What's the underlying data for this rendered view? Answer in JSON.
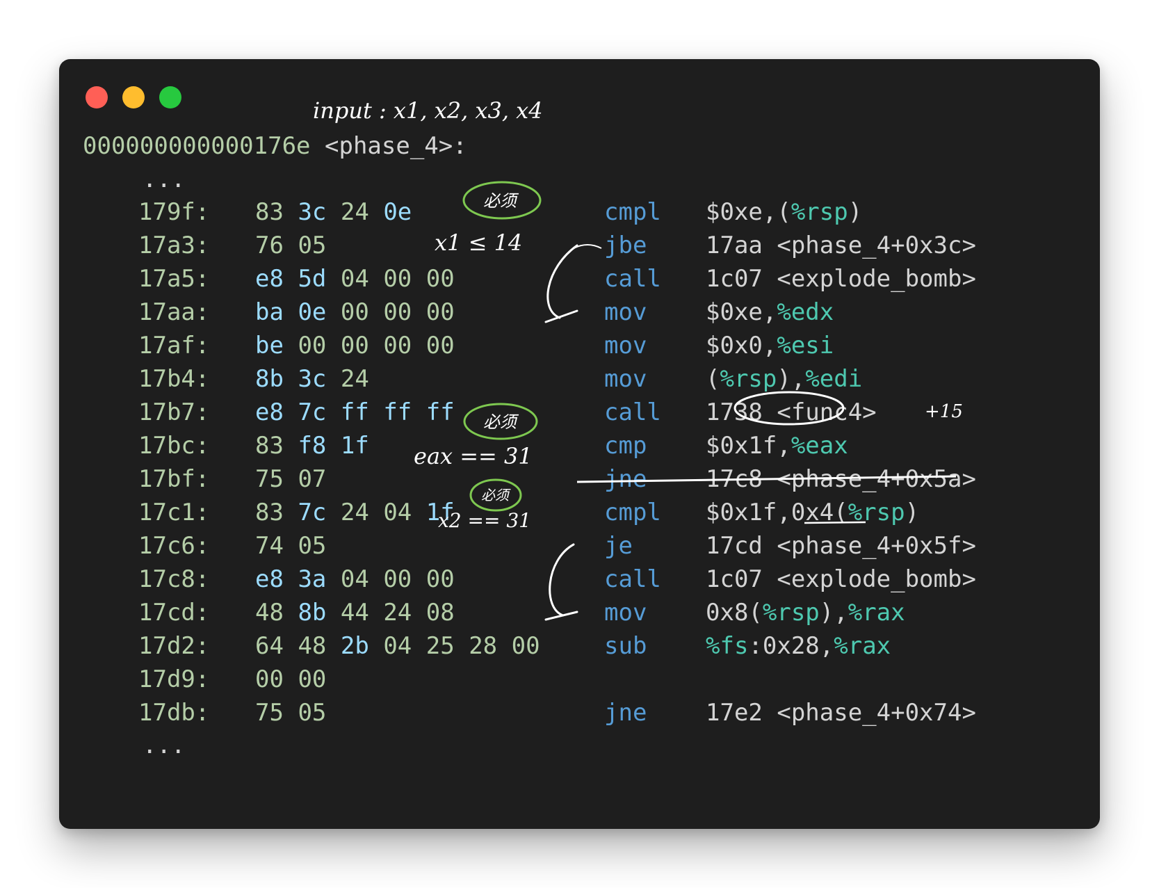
{
  "window": {
    "controls": [
      {
        "name": "close",
        "color": "#ff5f56"
      },
      {
        "name": "minimize",
        "color": "#ffbd2e"
      },
      {
        "name": "zoom",
        "color": "#27c93f"
      }
    ]
  },
  "header": {
    "address": "000000000000176e",
    "symbol": "<phase_4>:"
  },
  "ellipsis": "...",
  "rows": [
    {
      "addr": "179f:",
      "bytes": [
        "83",
        "3c",
        "24",
        "0e"
      ],
      "op": "cmpl",
      "args": "$0xe,(%rsp)"
    },
    {
      "addr": "17a3:",
      "bytes": [
        "76",
        "05"
      ],
      "op": "jbe",
      "args": "17aa <phase_4+0x3c>"
    },
    {
      "addr": "17a5:",
      "bytes": [
        "e8",
        "5d",
        "04",
        "00",
        "00"
      ],
      "op": "call",
      "args": "1c07 <explode_bomb>"
    },
    {
      "addr": "17aa:",
      "bytes": [
        "ba",
        "0e",
        "00",
        "00",
        "00"
      ],
      "op": "mov",
      "args": "$0xe,%edx"
    },
    {
      "addr": "17af:",
      "bytes": [
        "be",
        "00",
        "00",
        "00",
        "00"
      ],
      "op": "mov",
      "args": "$0x0,%esi"
    },
    {
      "addr": "17b4:",
      "bytes": [
        "8b",
        "3c",
        "24"
      ],
      "op": "mov",
      "args": "(%rsp),%edi"
    },
    {
      "addr": "17b7:",
      "bytes": [
        "e8",
        "7c",
        "ff",
        "ff",
        "ff"
      ],
      "op": "call",
      "args": "1738 <func4>"
    },
    {
      "addr": "17bc:",
      "bytes": [
        "83",
        "f8",
        "1f"
      ],
      "op": "cmp",
      "args": "$0x1f,%eax"
    },
    {
      "addr": "17bf:",
      "bytes": [
        "75",
        "07"
      ],
      "op": "jne",
      "args": "17c8 <phase_4+0x5a>"
    },
    {
      "addr": "17c1:",
      "bytes": [
        "83",
        "7c",
        "24",
        "04",
        "1f"
      ],
      "op": "cmpl",
      "args": "$0x1f,0x4(%rsp)"
    },
    {
      "addr": "17c6:",
      "bytes": [
        "74",
        "05"
      ],
      "op": "je",
      "args": "17cd <phase_4+0x5f>"
    },
    {
      "addr": "17c8:",
      "bytes": [
        "e8",
        "3a",
        "04",
        "00",
        "00"
      ],
      "op": "call",
      "args": "1c07 <explode_bomb>"
    },
    {
      "addr": "17cd:",
      "bytes": [
        "48",
        "8b",
        "44",
        "24",
        "08"
      ],
      "op": "mov",
      "args": "0x8(%rsp),%rax"
    },
    {
      "addr": "17d2:",
      "bytes": [
        "64",
        "48",
        "2b",
        "04",
        "25",
        "28",
        "00"
      ],
      "op": "sub",
      "args": "%fs:0x28,%rax"
    },
    {
      "addr": "17d9:",
      "bytes": [
        "00",
        "00"
      ],
      "op": "",
      "args": ""
    },
    {
      "addr": "17db:",
      "bytes": [
        "75",
        "05"
      ],
      "op": "jne",
      "args": "17e2 <phase_4+0x74>"
    }
  ],
  "annotations": {
    "input_note": "input : x1, x2, x3, x4",
    "must_label_1": "必须",
    "x1_condition": "x1 ≤ 14",
    "must_label_2": "必须",
    "eax_condition": "eax == 31",
    "must_label_3": "必须",
    "x2_condition": "x2 == 31",
    "side_note": "+15",
    "colors": {
      "ink": "#ffffff",
      "highlight_circle": "#7ec850"
    }
  }
}
